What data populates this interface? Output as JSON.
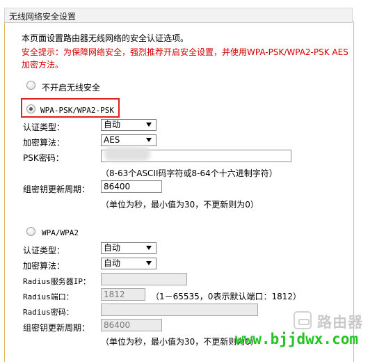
{
  "title": "无线网络安全设置",
  "intro": "本页面设置路由器无线网络的安全认证选项。",
  "warning_line1": "安全提示：为保障网络安全，强烈推荐开启安全设置，并使用WPA-PSK/WPA2-PSK AES",
  "warning_line2": "加密方法。",
  "options": {
    "disable_label": "不开启无线安全",
    "wpa_psk_label": "WPA-PSK/WPA2-PSK",
    "wpa_label": "WPA/WPA2"
  },
  "psk": {
    "auth_label": "认证类型：",
    "auth_value": "自动",
    "enc_label": "加密算法：",
    "enc_value": "AES",
    "key_label": "PSK密码：",
    "key_value": "",
    "key_hint": "（8-63个ASCII码字符或8-64个十六进制字符）",
    "renew_label": "组密钥更新周期：",
    "renew_value": "86400",
    "renew_hint": "（单位为秒，最小值为30，不更新则为0）"
  },
  "wpa": {
    "auth_label": "认证类型：",
    "auth_value": "自动",
    "enc_label": "加密算法：",
    "enc_value": "自动",
    "server_label": "Radius服务器IP：",
    "server_value": "",
    "port_label": "Radius端口：",
    "port_value": "1812",
    "port_hint": "（1－65535，0表示默认端口：1812）",
    "pwd_label": "Radius密码：",
    "pwd_value": "",
    "renew_label": "组密钥更新周期：",
    "renew_value": "86400",
    "renew_hint": "（单位为秒，最小值为30，不更新则为0）"
  },
  "watermark": {
    "brand": "路由器",
    "url": "www.bjjdwx.com",
    "icon": "router-icon"
  },
  "colors": {
    "warning": "#d20000",
    "highlight": "#e02020",
    "panel_border": "#e5b860",
    "watermark_url": "#24c424"
  }
}
